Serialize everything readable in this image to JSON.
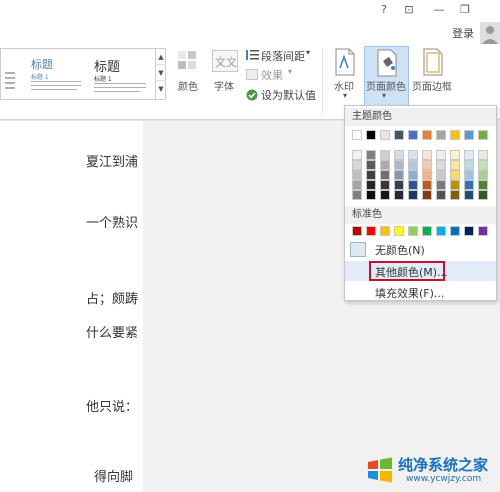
{
  "window": {
    "help_label": "?",
    "ribbon_display_label": "⊡",
    "minimize_label": "—",
    "restore_label": "❐",
    "login_label": "登录"
  },
  "ribbon": {
    "style_gallery": {
      "heading_tiles": [
        "标题",
        "标题"
      ],
      "subheadings": [
        "标题 1",
        "标题 1"
      ]
    },
    "colors_label": "颜色",
    "fonts_label": "字体",
    "font_icon_text": "文文",
    "paragraph_spacing_label": "段落间距",
    "effects_label": "效果",
    "set_as_default_label": "设为默认值",
    "watermark_label": "水印",
    "page_color_label": "页面颜色",
    "page_borders_label": "页面边框"
  },
  "document": {
    "lines": [
      "夏江到浦",
      "一个熟识",
      "占；颇踌",
      "什么要紧",
      "他只说：",
      "得向脚"
    ]
  },
  "page_color_menu": {
    "theme_colors_header": "主题颜色",
    "standard_colors_header": "标准色",
    "no_color_label": "无颜色(N)",
    "more_colors_label": "其他颜色(M)...",
    "fill_effects_label": "填充效果(F)...",
    "theme_colors": [
      [
        "#ffffff",
        "#000000",
        "#e7e6e6",
        "#44546a",
        "#4472c4",
        "#ed7d31",
        "#a5a5a5",
        "#ffc000",
        "#5b9bd5",
        "#70ad47"
      ],
      [
        "#f2f2f2",
        "#808080",
        "#d0cece",
        "#d6dce4",
        "#d9e2f3",
        "#fbe4d5",
        "#ededed",
        "#fff2cc",
        "#deebf6",
        "#e2efd9"
      ],
      [
        "#d8d8d8",
        "#595959",
        "#aeaaaa",
        "#adb9ca",
        "#b4c6e7",
        "#f7caac",
        "#dbdbdb",
        "#fee599",
        "#bdd7ee",
        "#c5e0b3"
      ],
      [
        "#bfbfbf",
        "#404040",
        "#757070",
        "#8496b0",
        "#8eaadb",
        "#f4b183",
        "#c9c9c9",
        "#ffd965",
        "#9cc3e5",
        "#a8d08d"
      ],
      [
        "#a5a5a5",
        "#262626",
        "#3a3838",
        "#323f4f",
        "#2f5496",
        "#c55a11",
        "#7b7b7b",
        "#bf8f00",
        "#2e75b5",
        "#538135"
      ],
      [
        "#7f7f7f",
        "#0d0d0d",
        "#171616",
        "#222a35",
        "#1f3864",
        "#833c0b",
        "#525252",
        "#7f6000",
        "#1e4e79",
        "#375623"
      ]
    ],
    "standard_colors": [
      "#c00000",
      "#ff0000",
      "#ffc000",
      "#ffff00",
      "#92d050",
      "#00b050",
      "#00b0f0",
      "#0070c0",
      "#002060",
      "#7030a0"
    ]
  },
  "watermark_logo": {
    "title": "纯净系统之家",
    "url": "www.ycwjzy.com"
  }
}
